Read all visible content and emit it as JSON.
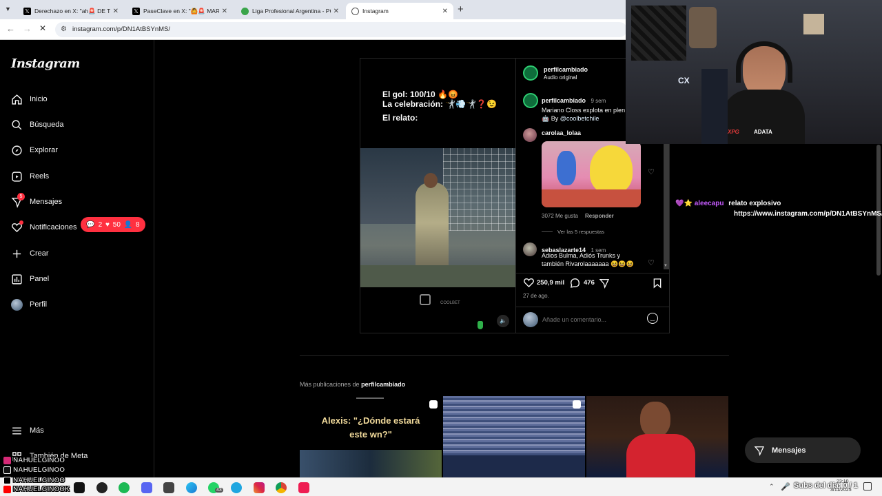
{
  "browser": {
    "tabs": [
      {
        "title": "Derechazo en X: \"ah🚨 DE TERF",
        "icon": "x-logo-icon"
      },
      {
        "title": "PaseClave en X: \"🙆🚨 MARIANO",
        "icon": "x-logo-icon"
      },
      {
        "title": "Liga Profesional Argentina - PC",
        "icon": "lpf-icon"
      },
      {
        "title": "Instagram",
        "icon": "instagram-icon"
      }
    ],
    "url": "instagram.com/p/DN1AtBSYnMS/"
  },
  "sidebar": {
    "logo": "Instagram",
    "items": [
      {
        "label": "Inicio",
        "icon": "home-icon"
      },
      {
        "label": "Búsqueda",
        "icon": "search-icon"
      },
      {
        "label": "Explorar",
        "icon": "compass-icon"
      },
      {
        "label": "Reels",
        "icon": "reels-icon"
      },
      {
        "label": "Mensajes",
        "icon": "messenger-icon",
        "badge": "5"
      },
      {
        "label": "Notificaciones",
        "icon": "heart-icon"
      },
      {
        "label": "Crear",
        "icon": "plus-icon"
      },
      {
        "label": "Panel",
        "icon": "chart-icon"
      },
      {
        "label": "Perfil",
        "icon": "avatar-icon"
      }
    ],
    "more": "Más",
    "also_meta": "También de Meta",
    "notif_popup": {
      "comments": "2",
      "likes": "50",
      "follows": "8"
    }
  },
  "post": {
    "caption_line1": "El gol: 100/10 🔥😡",
    "caption_line2": "La celebración: 🤺💨🤺❓😉",
    "caption_line3": "El relato:",
    "author": "perfilcambiado",
    "audio": "Audio original",
    "main_comment": {
      "user": "perfilcambiado",
      "time": "9 sem",
      "text": "Mariano Closs explota en plen",
      "text2": "By",
      "mention": "@coolbetchile"
    },
    "comments": [
      {
        "user": "carolaa_lolaa",
        "likes": "3072 Me gusta",
        "reply": "Responder",
        "view_replies": "Ver las 5 respuestas"
      },
      {
        "user": "sebaslazarte14",
        "time": "1 sem",
        "text1": "Adios Bulma, Adiós Trunks y",
        "text2": "también Rivarolaaaaaaa 😆😆😆"
      }
    ],
    "likes": "250,9 mil",
    "comment_count": "476",
    "date": "27 de ago.",
    "add_comment_placeholder": "Añade un comentario..."
  },
  "webcam": {
    "label1": "CX",
    "label2": "XPG",
    "label3": "ADATA"
  },
  "chat": {
    "user": "aleecapu",
    "message": "relato explosivo",
    "link": "https://www.instagram.com/p/DN1AtBSYnMS/"
  },
  "more_posts": {
    "label": "Más publicaciones de",
    "author": "perfilcambiado",
    "thumb1_text": "Alexis: \"¿Dónde estará este wn?\""
  },
  "messages_pill": "Mensajes",
  "stream_overlay": {
    "handles": [
      "NAHUELGINOO",
      "NAHUELGINOO",
      "NAHUELGINOO",
      "NAHUELGINOOK"
    ]
  },
  "taskbar": {
    "ticker": "Subs del día: 0 / 1",
    "time": "23:10",
    "date": "3/11/2025",
    "whatsapp_badge": "43"
  }
}
